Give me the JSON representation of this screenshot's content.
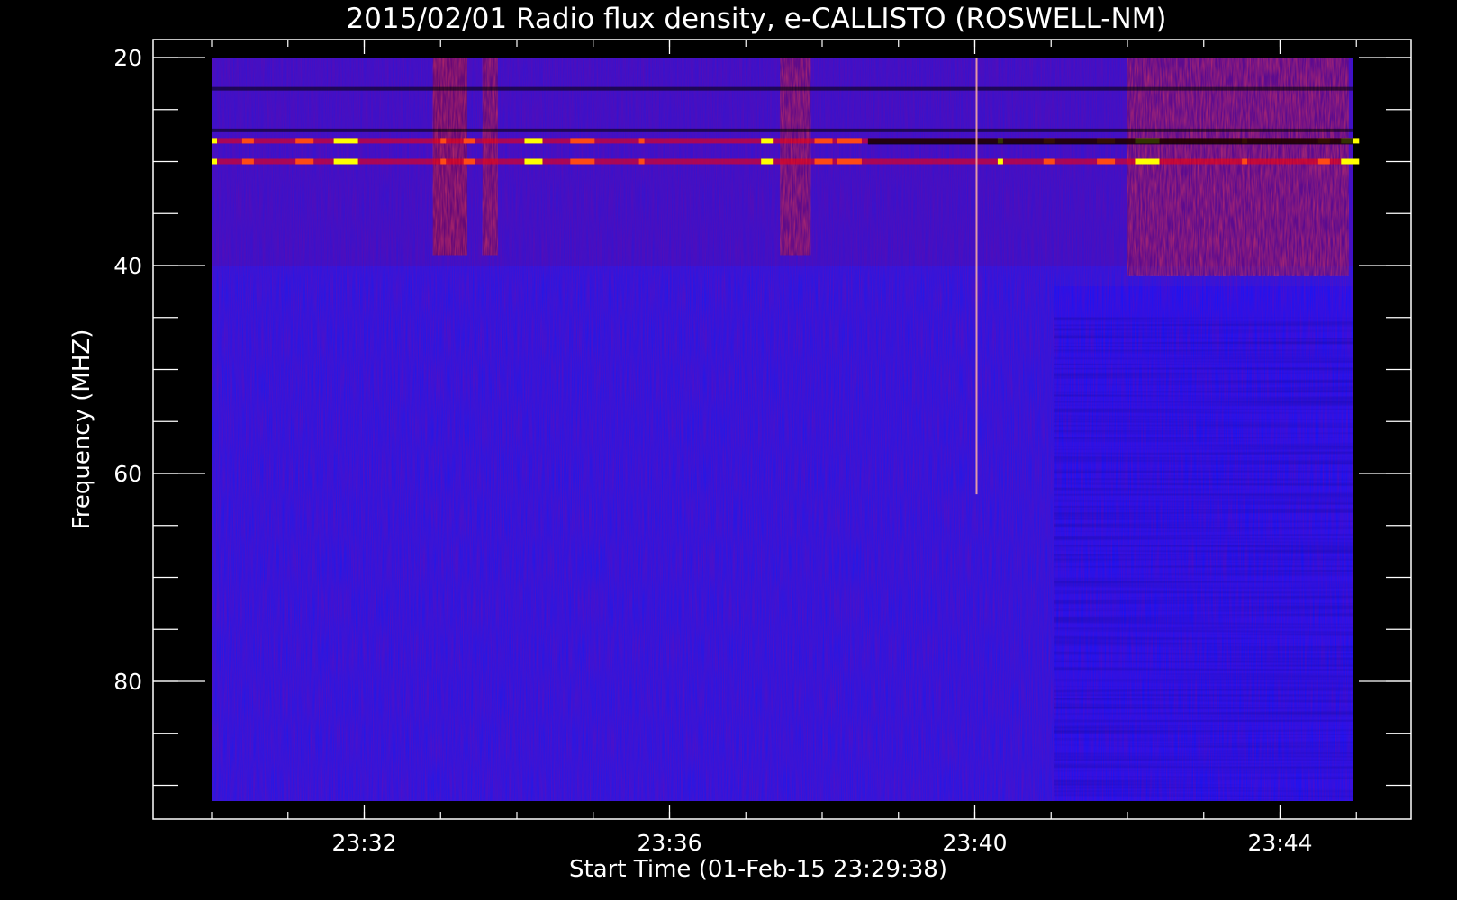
{
  "chart_data": {
    "type": "heatmap",
    "title": "2015/02/01  Radio flux density, e-CALLISTO (ROSWELL-NM)",
    "xlabel": "Start Time (01-Feb-15 23:29:38)",
    "ylabel": "Frequency (MHZ)",
    "x_range": [
      "23:29:38",
      "23:45:45"
    ],
    "y_range": [
      20,
      92
    ],
    "y_axis_inverted": true,
    "x_ticks": [
      {
        "label": "23:32",
        "minutes": 32
      },
      {
        "label": "23:36",
        "minutes": 36
      },
      {
        "label": "23:40",
        "minutes": 40
      },
      {
        "label": "23:44",
        "minutes": 44
      }
    ],
    "x_minor_tick_minutes": [
      30,
      31,
      32,
      33,
      34,
      35,
      36,
      37,
      38,
      39,
      40,
      41,
      42,
      43,
      44,
      45
    ],
    "y_ticks": [
      20,
      40,
      60,
      80
    ],
    "y_minor_ticks": [
      20,
      25,
      30,
      35,
      40,
      45,
      50,
      55,
      60,
      65,
      70,
      75,
      80,
      85,
      90
    ],
    "colormap": [
      "#000000",
      "#0000ff",
      "#ff0000",
      "#ffff00",
      "#ffffff"
    ],
    "background_color": "#000000",
    "axis_color": "#ffffff",
    "data_start_minutes": 30,
    "data_end_minutes": 44.95,
    "bursts": [
      {
        "start_minutes": 32.9,
        "end_minutes": 33.35,
        "freq_low": 20,
        "freq_high": 39,
        "intensity": 0.65
      },
      {
        "start_minutes": 33.55,
        "end_minutes": 33.75,
        "freq_low": 20,
        "freq_high": 39,
        "intensity": 0.55
      },
      {
        "start_minutes": 37.45,
        "end_minutes": 37.85,
        "freq_low": 20,
        "freq_high": 39,
        "intensity": 0.5
      },
      {
        "start_minutes": 42.0,
        "end_minutes": 44.9,
        "freq_low": 20,
        "freq_high": 41,
        "intensity": 0.45
      }
    ],
    "rfi_bands": [
      {
        "freq": 28,
        "type": "hot"
      },
      {
        "freq": 30,
        "type": "hot"
      },
      {
        "freq": 27,
        "type": "dark"
      },
      {
        "freq": 23,
        "type": "dark"
      }
    ],
    "spike": {
      "minutes": 40.0,
      "freq_low": 20,
      "freq_high": 62
    }
  }
}
